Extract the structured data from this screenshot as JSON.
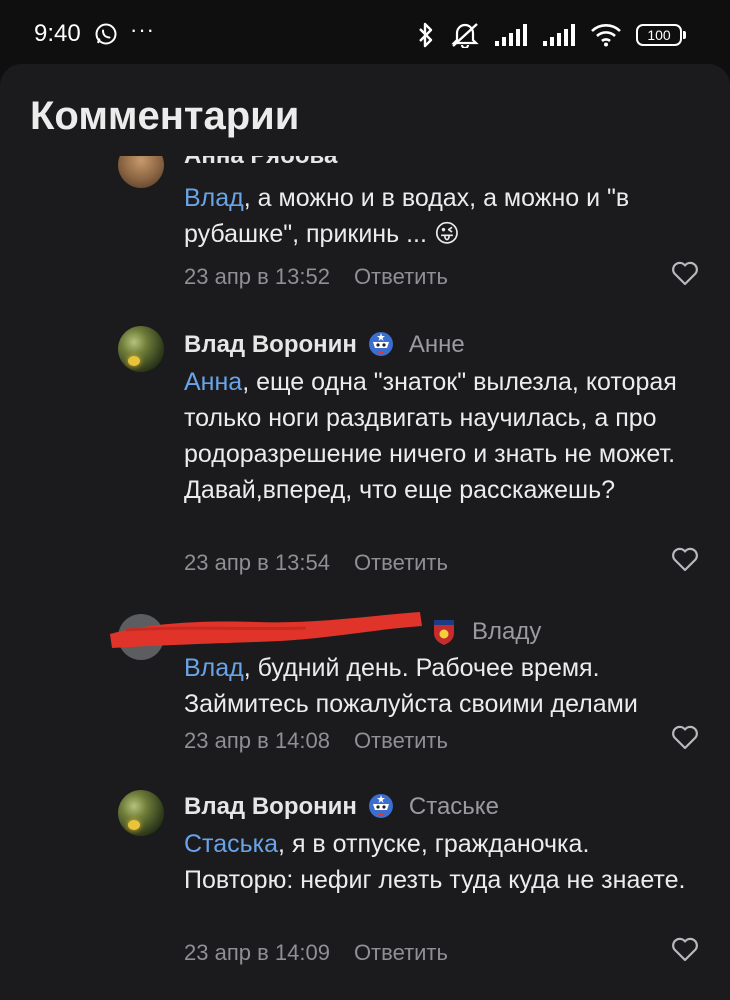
{
  "status_bar": {
    "time": "9:40",
    "icons": [
      "whatsapp-icon",
      "more-dots-icon",
      "bluetooth-icon",
      "mute-icon",
      "signal-icon",
      "signal-icon",
      "wifi-icon",
      "battery-icon"
    ],
    "battery": "100"
  },
  "sheet": {
    "title": "Комментарии"
  },
  "comments": [
    {
      "author": "Анна Рябова",
      "reply_to": "",
      "mention": "Влад",
      "text": ", а можно и в водах, а можно и \"в рубашке\", прикинь ... 😜",
      "date": "23 апр в 13:52",
      "reply_label": "Ответить"
    },
    {
      "author": "Влад Воронин",
      "reply_to": "Анне",
      "mention": "Анна",
      "text": ", еще одна \"знаток\" вылезла, которая только ноги раздвигать научилась, а про родоразрешение ничего и знать не может. Давай,вперед, что еще расскажешь?",
      "date": "23 апр в 13:54",
      "reply_label": "Ответить"
    },
    {
      "author": "",
      "reply_to": "Владу",
      "mention": "Влад",
      "text": ", будний день. Рабочее время. Займитесь пожалуйста своими делами",
      "date": "23 апр в 14:08",
      "reply_label": "Ответить"
    },
    {
      "author": "Влад Воронин",
      "reply_to": "Стаське",
      "mention": "Стаська",
      "text": ", я в отпуске, гражданочка. Повторю: нефиг лезть туда куда не знаете.",
      "date": "23 апр в 14:09",
      "reply_label": "Ответить"
    }
  ],
  "colors": {
    "background": "#0f0f0f",
    "sheet": "#1b1b1d",
    "mention": "#6aa4e8",
    "secondary_text": "#8f8f94",
    "redaction": "#e0332a"
  }
}
